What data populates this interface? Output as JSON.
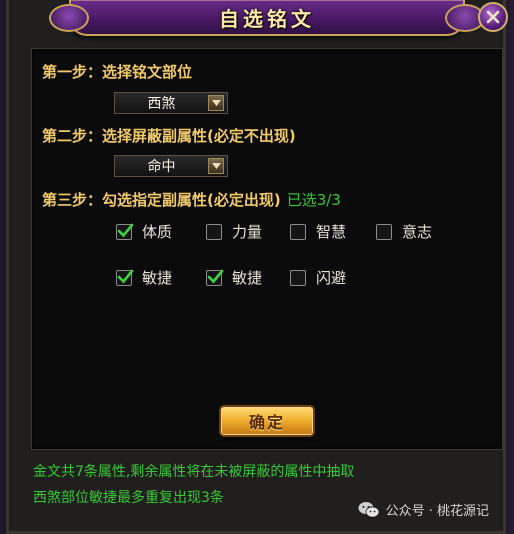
{
  "window": {
    "title": "自选铭文",
    "close_icon": "close-x-icon"
  },
  "step1": {
    "label": "第一步：选择铭文部位",
    "select_value": "西煞"
  },
  "step2": {
    "label": "第二步：选择屏蔽副属性(必定不出现)",
    "select_value": "命中"
  },
  "step3": {
    "label": "第三步：勾选指定副属性(必定出现)",
    "selected_count": "已选3/3",
    "options": [
      {
        "label": "体质",
        "checked": true
      },
      {
        "label": "力量",
        "checked": false
      },
      {
        "label": "智慧",
        "checked": false
      },
      {
        "label": "意志",
        "checked": false
      },
      {
        "label": "敏捷",
        "checked": true
      },
      {
        "label": "敏捷",
        "checked": true
      },
      {
        "label": "闪避",
        "checked": false
      }
    ]
  },
  "confirm_label": "确定",
  "info": {
    "line1": "金文共7条属性,剩余属性将在未被屏蔽的属性中抽取",
    "line2": "西煞部位敏捷最多重复出现3条"
  },
  "watermark": {
    "text": "公众号 · 桃花源记",
    "icon": "wechat-icon"
  },
  "colors": {
    "step_label": "#f2c96a",
    "highlight_green": "#35c935",
    "title_purple": "#4a1a66",
    "button_gold": "#f0b030"
  }
}
